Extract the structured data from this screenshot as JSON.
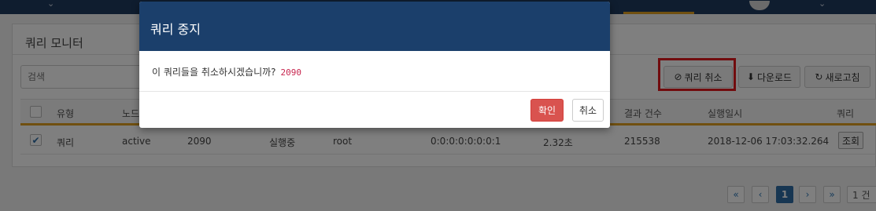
{
  "panel": {
    "title": "쿼리 모니터"
  },
  "search": {
    "placeholder": "검색"
  },
  "toolbar": {
    "cancel_label": "쿼리 취소",
    "download_label": "다운로드",
    "refresh_label": "새로고침"
  },
  "table": {
    "columns": [
      "유형",
      "노드",
      "결과 건수",
      "실행일시",
      "쿼리"
    ],
    "row": {
      "type": "쿼리",
      "node": "active",
      "id": "2090",
      "status": "실행중",
      "user": "root",
      "address": "0:0:0:0:0:0:0:1",
      "elapsed": "2.32초",
      "result_count": "215538",
      "executed_at": "2018-12-06 17:03:32.264",
      "view_label": "조회",
      "checked": true
    }
  },
  "pagination": {
    "first": "«",
    "prev": "‹",
    "current": "1",
    "next": "›",
    "last": "»",
    "total": "1 건"
  },
  "modal": {
    "title": "쿼리 중지",
    "message": "이 쿼리들을 취소하시겠습니까?",
    "ids": "2090",
    "confirm_label": "확인",
    "cancel_label": "취소"
  },
  "colors": {
    "header": "#1b3f6b",
    "accent": "#e0a020",
    "danger": "#d9534f",
    "highlight": "#e3181c"
  }
}
